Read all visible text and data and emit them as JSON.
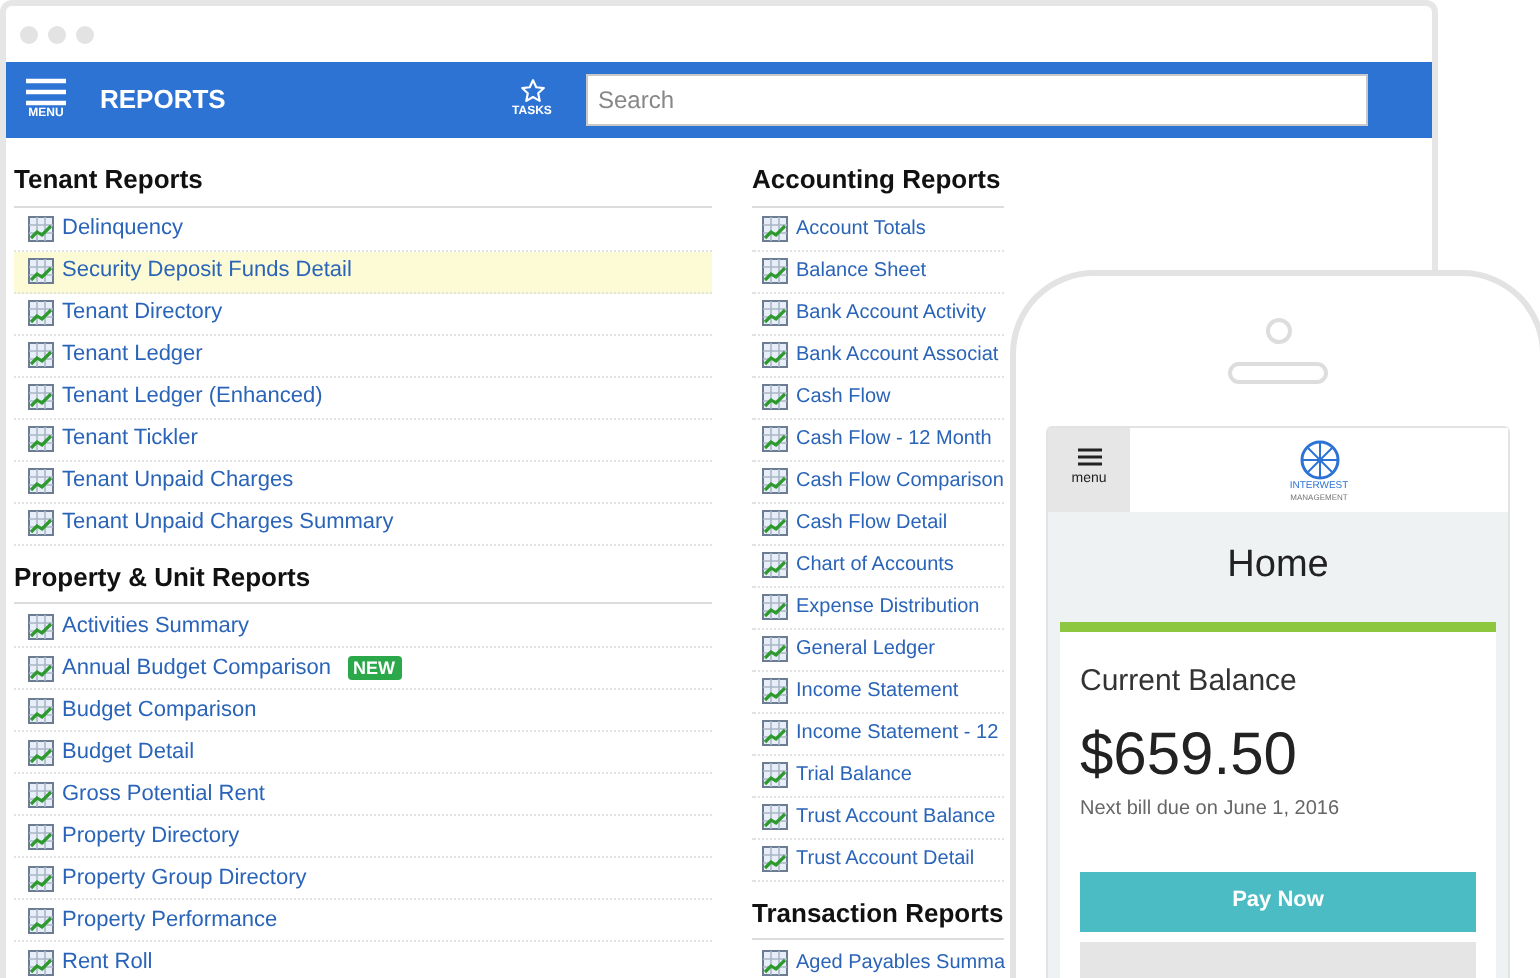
{
  "header": {
    "menu_label": "MENU",
    "title": "REPORTS",
    "tasks_label": "TASKS",
    "search": {
      "placeholder": "Search"
    }
  },
  "columns": [
    {
      "sections": [
        {
          "title": "Tenant Reports",
          "items": [
            {
              "label": "Delinquency",
              "selected": false
            },
            {
              "label": "Security Deposit Funds Detail",
              "selected": true
            },
            {
              "label": "Tenant Directory",
              "selected": false
            },
            {
              "label": "Tenant Ledger",
              "selected": false
            },
            {
              "label": "Tenant Ledger (Enhanced)",
              "selected": false
            },
            {
              "label": "Tenant Tickler",
              "selected": false
            },
            {
              "label": "Tenant Unpaid Charges",
              "selected": false
            },
            {
              "label": "Tenant Unpaid Charges Summary",
              "selected": false
            }
          ]
        },
        {
          "title": "Property & Unit Reports",
          "items": [
            {
              "label": "Activities Summary",
              "selected": false
            },
            {
              "label": "Annual Budget Comparison",
              "selected": false,
              "badge": "NEW"
            },
            {
              "label": "Budget Comparison",
              "selected": false
            },
            {
              "label": "Budget Detail",
              "selected": false
            },
            {
              "label": "Gross Potential Rent",
              "selected": false
            },
            {
              "label": "Property Directory",
              "selected": false
            },
            {
              "label": "Property Group Directory",
              "selected": false
            },
            {
              "label": "Property Performance",
              "selected": false
            },
            {
              "label": "Rent Roll",
              "selected": false
            }
          ]
        }
      ]
    },
    {
      "sections": [
        {
          "title": "Accounting Reports",
          "items": [
            {
              "label": "Account Totals",
              "selected": false
            },
            {
              "label": "Balance Sheet",
              "selected": false
            },
            {
              "label": "Bank Account Activity",
              "selected": false
            },
            {
              "label": "Bank Account Associat",
              "selected": false
            },
            {
              "label": "Cash Flow",
              "selected": false
            },
            {
              "label": "Cash Flow - 12 Month",
              "selected": false
            },
            {
              "label": "Cash Flow Comparison",
              "selected": false
            },
            {
              "label": "Cash Flow Detail",
              "selected": false
            },
            {
              "label": "Chart of Accounts",
              "selected": false
            },
            {
              "label": "Expense Distribution",
              "selected": false
            },
            {
              "label": "General Ledger",
              "selected": false
            },
            {
              "label": "Income Statement",
              "selected": false
            },
            {
              "label": "Income Statement - 12",
              "selected": false
            },
            {
              "label": "Trial Balance",
              "selected": false
            },
            {
              "label": "Trust Account Balance",
              "selected": false
            },
            {
              "label": "Trust Account Detail",
              "selected": false
            }
          ]
        },
        {
          "title": "Transaction Reports",
          "items": [
            {
              "label": "Aged Payables Summa",
              "selected": false
            }
          ]
        }
      ]
    }
  ],
  "phone": {
    "menu_label": "menu",
    "logo_text": "INTERWEST",
    "logo_subtext": "MANAGEMENT",
    "page_title": "Home",
    "card": {
      "title": "Current Balance",
      "amount": "$659.50",
      "note": "Next bill due on June 1, 2016",
      "primary_button": "Pay Now"
    }
  }
}
